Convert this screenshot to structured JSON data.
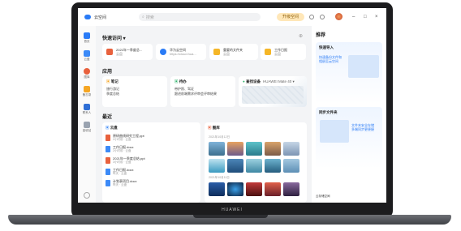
{
  "device": {
    "brand": "HUAWEI"
  },
  "titlebar": {
    "app_name": "云空间",
    "search_placeholder": "搜索",
    "upgrade": "升级空间"
  },
  "sidebar": {
    "items": [
      {
        "label": "首页",
        "icon": "home-icon",
        "color": "#2a7bf6"
      },
      {
        "label": "云盘",
        "icon": "cloud-drive-icon",
        "color": "#3c8af7"
      },
      {
        "label": "图库",
        "icon": "gallery-icon",
        "color": "#e8613d"
      },
      {
        "label": "备忘录",
        "icon": "notes-icon",
        "color": "#f5a623"
      },
      {
        "label": "联系人",
        "icon": "contacts-icon",
        "color": "#2f6fd6"
      },
      {
        "label": "回收站",
        "icon": "trash-icon",
        "color": "#9aa3b0"
      }
    ]
  },
  "quick_access": {
    "title": "快速访问 ▾",
    "items": [
      {
        "name": "2021年一季度总...",
        "sub": "云盘",
        "color": "#e8613d"
      },
      {
        "name": "华为云空间",
        "sub": "https://cloud.hua...",
        "color": "#2a7bf6"
      },
      {
        "name": "重要的文件夹",
        "sub": "云盘",
        "color": "#f5b627"
      },
      {
        "name": "工作日报",
        "sub": "云盘",
        "color": "#f5b627"
      }
    ]
  },
  "apps": {
    "title": "应用",
    "notes": {
      "title": "笔记",
      "rows": [
        "旅行游记",
        "季度总结"
      ]
    },
    "tasks": {
      "title": "待办",
      "rows": [
        "带护照、驾证",
        "跟进前端需求评审会评审结果"
      ]
    },
    "map": {
      "title": "查找设备",
      "device": "HUAWEI Mate 40 ▾"
    }
  },
  "recent": {
    "title": "最近",
    "drive": {
      "title": "云盘",
      "files": [
        {
          "name": "原研曲线研究工程.ppt",
          "meta": "2小时前 · 云盘"
        },
        {
          "name": "工作日报.docx",
          "meta": "2小时前 · 云盘"
        },
        {
          "name": "2021年一季度总结.ppt",
          "meta": "3小时前 · 云盘"
        },
        {
          "name": "工作日报.docx",
          "meta": "昨天 · 云盘"
        },
        {
          "name": "计划表项目.docx",
          "meta": "昨天 · 云盘"
        }
      ]
    },
    "gallery": {
      "title": "图库",
      "date1": "2021年10月12日",
      "date2": "2021年10月11日"
    }
  },
  "recommend": {
    "title": "推荐",
    "card1": {
      "title": "快速导入",
      "desc": "快速备份文件和\n相册至云空间"
    },
    "card2": {
      "title": "同步文件夹",
      "desc": "文件夹安全存储\n多端同步更便捷"
    },
    "footer": "云存储空间"
  }
}
